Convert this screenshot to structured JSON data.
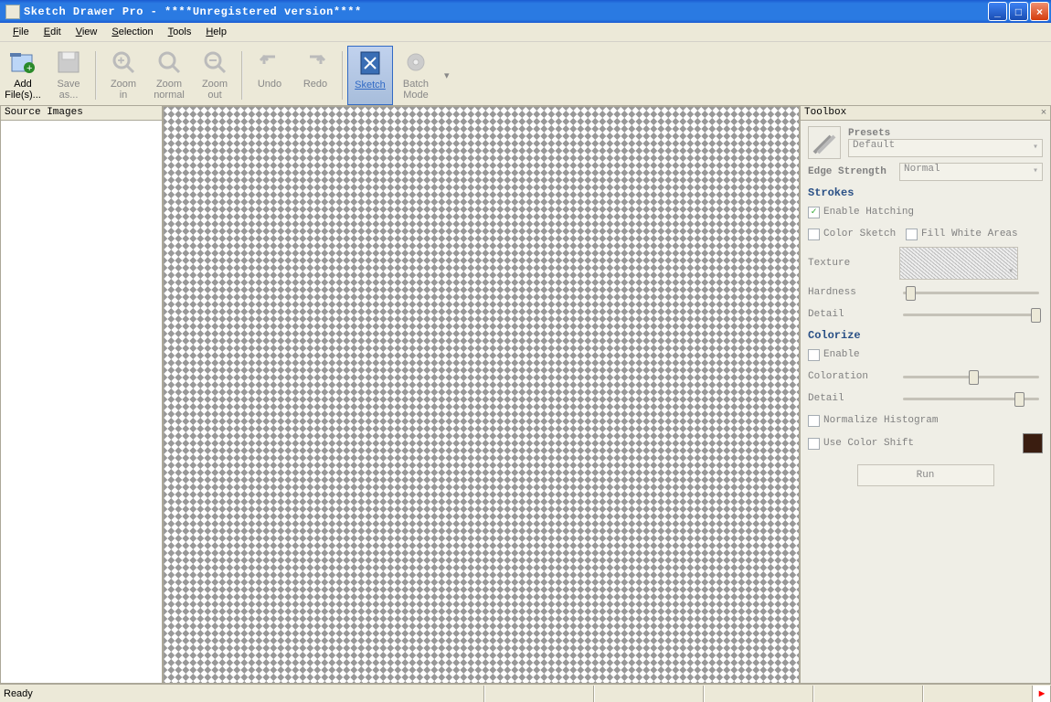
{
  "title": "Sketch Drawer Pro - ****Unregistered version****",
  "menu": {
    "file": "File",
    "edit": "Edit",
    "view": "View",
    "selection": "Selection",
    "tools": "Tools",
    "help": "Help"
  },
  "toolbar": {
    "addFiles": "Add\nFile(s)...",
    "saveAs": "Save\nas...",
    "zoomIn": "Zoom\nin",
    "zoomNormal": "Zoom\nnormal",
    "zoomOut": "Zoom\nout",
    "undo": "Undo",
    "redo": "Redo",
    "sketch": "Sketch",
    "batch": "Batch\nMode"
  },
  "sourcePanel": {
    "title": "Source Images"
  },
  "toolbox": {
    "title": "Toolbox",
    "presets": {
      "label": "Presets",
      "value": "Default"
    },
    "edgeStrength": {
      "label": "Edge Strength",
      "value": "Normal"
    },
    "strokes": {
      "header": "Strokes",
      "enableHatching": {
        "label": "Enable Hatching",
        "checked": true
      },
      "colorSketch": {
        "label": "Color Sketch",
        "checked": false
      },
      "fillWhite": {
        "label": "Fill White Areas",
        "checked": false
      },
      "texture": "Texture",
      "hardness": {
        "label": "Hardness",
        "value": 5
      },
      "detail": {
        "label": "Detail",
        "value": 98
      }
    },
    "colorize": {
      "header": "Colorize",
      "enable": {
        "label": "Enable",
        "checked": false
      },
      "coloration": {
        "label": "Coloration",
        "value": 50
      },
      "detail": {
        "label": "Detail",
        "value": 85
      },
      "normalize": {
        "label": "Normalize Histogram",
        "checked": false
      },
      "colorShift": {
        "label": "Use Color Shift",
        "checked": false,
        "color": "#3a1d10"
      }
    },
    "run": "Run"
  },
  "status": {
    "ready": "Ready"
  }
}
